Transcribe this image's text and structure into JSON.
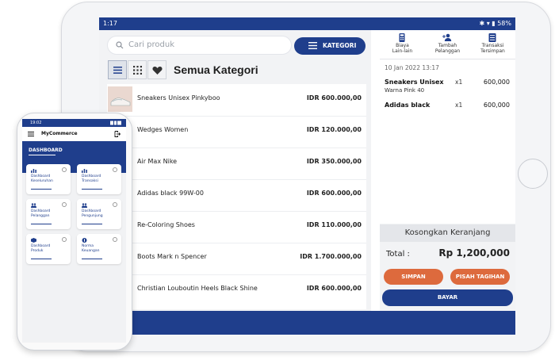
{
  "tablet": {
    "status_time": "1:17",
    "status_right": "✱ ▾ ▮ 58%",
    "search": {
      "placeholder": "Cari produk"
    },
    "kategori_label": "KATEGORI",
    "category_title": "Semua Kategori",
    "products": [
      {
        "name": "Sneakers Unisex Pinkyboo",
        "price": "IDR 600.000,00"
      },
      {
        "name": "Wedges Women",
        "price": "IDR 120.000,00"
      },
      {
        "name": "Air Max Nike",
        "price": "IDR 350.000,00"
      },
      {
        "name": "Adidas black 99W-00",
        "price": "IDR 600.000,00"
      },
      {
        "name": "Re-Coloring Shoes",
        "price": "IDR 110.000,00"
      },
      {
        "name": "Boots Mark n Spencer",
        "price": "IDR 1.700.000,00"
      },
      {
        "name": "Christian Louboutin Heels Black Shine",
        "price": "IDR 600.000,00"
      }
    ],
    "tabs": [
      {
        "line1": "Biaya",
        "line2": "Lain-lain",
        "icon": "calculator-icon"
      },
      {
        "line1": "Tambah",
        "line2": "Pelanggan",
        "icon": "add-user-icon"
      },
      {
        "line1": "Transaksi",
        "line2": "Tersimpan",
        "icon": "saved-list-icon"
      }
    ],
    "cart": {
      "date": "10 Jan 2022 13:17",
      "items": [
        {
          "name": "Sneakers Unisex",
          "variant": "Warna Pink 40",
          "qty": "x1",
          "price": "600,000"
        },
        {
          "name": "Adidas black",
          "variant": "",
          "qty": "x1",
          "price": "600,000"
        }
      ],
      "clear_label": "Kosongkan Keranjang",
      "total_label": "Total :",
      "total_value": "Rp 1,200,000",
      "save_label": "SIMPAN",
      "split_label": "PISAH TAGIHAN",
      "pay_label": "BAYAR"
    }
  },
  "phone": {
    "status_time": "19:02",
    "app_title": "MyCommerce",
    "dashboard_title": "DASHBOARD",
    "cards": [
      {
        "line1": "Dashboard",
        "line2": "Keseluruhan"
      },
      {
        "line1": "Dashboard",
        "line2": "Transaksi"
      },
      {
        "line1": "Dashboard",
        "line2": "Pelanggan"
      },
      {
        "line1": "Dashboard",
        "line2": "Pengunjung"
      },
      {
        "line1": "Dashboard",
        "line2": "Produk"
      },
      {
        "line1": "Norma",
        "line2": "Keuangan"
      }
    ]
  },
  "colors": {
    "primary": "#1f3e8c",
    "accent": "#dd6a3d"
  }
}
